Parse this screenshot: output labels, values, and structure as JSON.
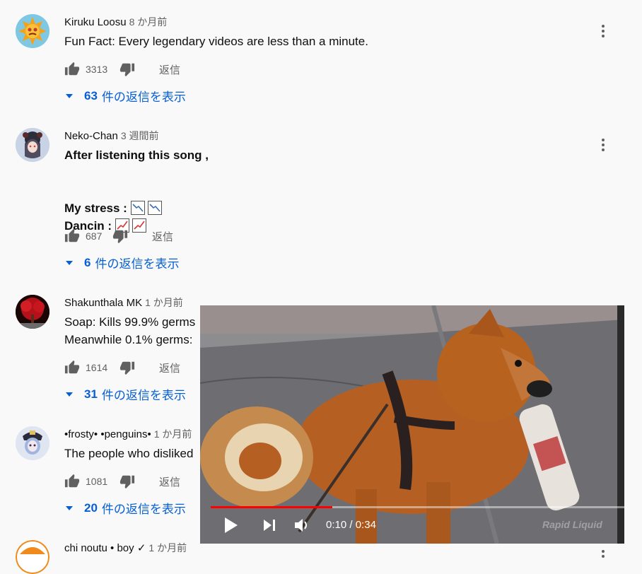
{
  "comments": [
    {
      "author": "Kiruku Loosu",
      "time": "8 か月前",
      "text": "Fun Fact: Every legendary videos are less than a minute.",
      "likes": "3313",
      "reply_label": "返信",
      "replies_count": "63",
      "replies_text": "件の返信を表示"
    },
    {
      "author": "Neko-Chan",
      "time": "3 週間前",
      "text_line1": "After listening this song ,",
      "text_line2": "My stress : ",
      "text_line3": "Dancin : ",
      "likes": "687",
      "reply_label": "返信",
      "replies_count": "6",
      "replies_text": "件の返信を表示"
    },
    {
      "author": "Shakunthala MK",
      "time": "1 か月前",
      "text_line1": "Soap: Kills 99.9% germs",
      "text_line2": "Meanwhile 0.1% germs:",
      "likes": "1614",
      "reply_label": "返信",
      "replies_count": "31",
      "replies_text": "件の返信を表示"
    },
    {
      "author": "•frosty• •penguins•",
      "time": "1 か月前",
      "text": "The people who disliked",
      "likes": "1081",
      "reply_label": "返信",
      "replies_count": "20",
      "replies_text": "件の返信を表示"
    },
    {
      "author": "chi noutu • boy ✓",
      "time": "1 か月前"
    }
  ],
  "player": {
    "time_current": "0:10",
    "time_separator": " / ",
    "time_total": "0:34",
    "progress_fraction": 0.294,
    "watermark": "Rapid Liquid"
  },
  "colors": {
    "link": "#065fd4",
    "progress": "#ff0000",
    "background": "#f9f9f9"
  }
}
